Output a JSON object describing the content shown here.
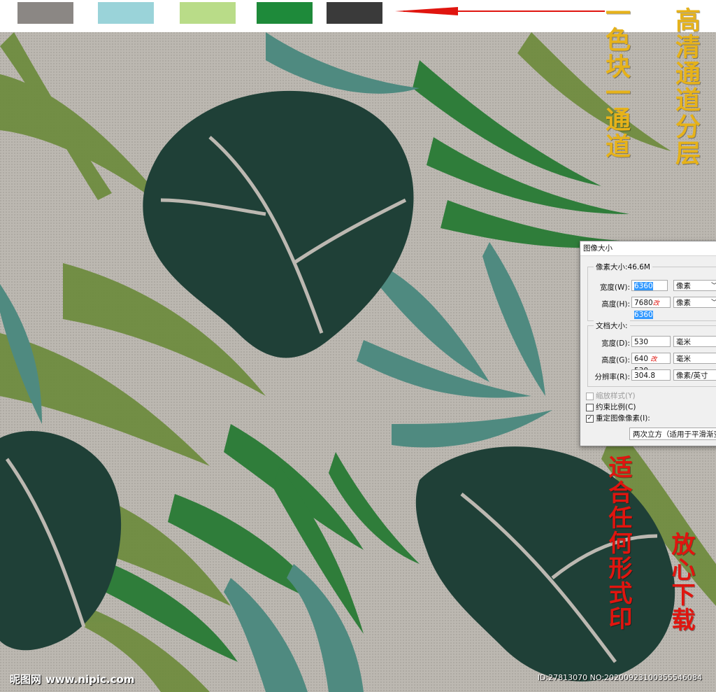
{
  "swatches": [
    {
      "name": "grey",
      "color": "#8b8784"
    },
    {
      "name": "light-blue",
      "color": "#9ad3d9"
    },
    {
      "name": "light-green",
      "color": "#b9dc88"
    },
    {
      "name": "green",
      "color": "#1e8a3a"
    },
    {
      "name": "dark-grey",
      "color": "#3a3a3a"
    }
  ],
  "colors": {
    "background_linen": "#b9b5ae",
    "monstera_dark": "#1f4037",
    "palm_green": "#2f7d3a",
    "olive_green": "#6b8a3a",
    "teal_leaf": "#4f8a80",
    "arrow_red": "#e0150f"
  },
  "annotations": {
    "left_gold": "一色块一通道",
    "right_gold": "高清通道分层",
    "left_red": "适合任何形式印",
    "right_red": "放心下载"
  },
  "dialog": {
    "title": "图像大小",
    "pixel_dims_label": "像素大小:46.6M",
    "width_label": "宽度(W):",
    "width_value": "6360",
    "width_unit": "像素",
    "height_label": "高度(H):",
    "height_old": "7680",
    "height_change_mark": "改",
    "height_value": "6360",
    "height_unit": "像素",
    "doc_size_label": "文档大小:",
    "doc_width_label": "宽度(D):",
    "doc_width_value": "530",
    "doc_width_unit": "毫米",
    "doc_height_label": "高度(G):",
    "doc_height_old": "640",
    "doc_height_mark": "改",
    "doc_height_value": "530",
    "doc_height_unit": "毫米",
    "resolution_label": "分辨率(R):",
    "resolution_value": "304.8",
    "resolution_unit": "像素/英寸",
    "scale_styles": "缩放样式(Y)",
    "constrain": "约束比例(C)",
    "resample": "重定图像像素(I):",
    "resample_method": "两次立方（适用于平滑渐变"
  },
  "watermark": {
    "logo": "昵图网",
    "site": "www.nipic.com",
    "id_text": "ID:27813070 NO:20200923100355546084"
  }
}
